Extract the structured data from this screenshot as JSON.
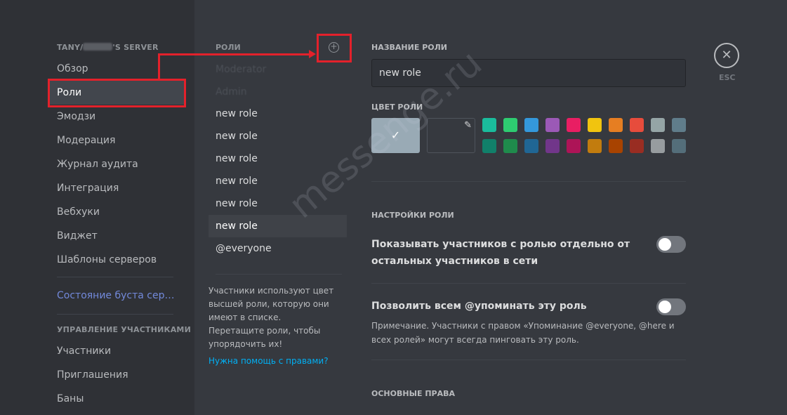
{
  "sidebar": {
    "server_name_prefix": "TANY/",
    "server_name_suffix": "'S SERVER",
    "items": [
      {
        "label": "Обзор"
      },
      {
        "label": "Роли"
      },
      {
        "label": "Эмодзи"
      },
      {
        "label": "Модерация"
      },
      {
        "label": "Журнал аудита"
      },
      {
        "label": "Интеграция"
      },
      {
        "label": "Вебхуки"
      },
      {
        "label": "Виджет"
      },
      {
        "label": "Шаблоны серверов"
      }
    ],
    "boost_label": "Состояние буста серв...",
    "members_header": "УПРАВЛЕНИЕ УЧАСТНИКАМИ",
    "member_items": [
      {
        "label": "Участники"
      },
      {
        "label": "Приглашения"
      },
      {
        "label": "Баны"
      }
    ]
  },
  "roles": {
    "header": "РОЛИ",
    "add_icon": "plus-circle-icon",
    "list": [
      {
        "label": "new role"
      },
      {
        "label": "new role"
      },
      {
        "label": "new role"
      },
      {
        "label": "new role"
      },
      {
        "label": "new role"
      },
      {
        "label": "new role"
      },
      {
        "label": "@everyone"
      }
    ],
    "note": "Участники используют цвет высшей роли, которую они имеют в списке. Перетащите роли, чтобы упорядочить их!",
    "help_link": "Нужна помощь с правами?"
  },
  "editor": {
    "name_label": "НАЗВАНИЕ РОЛИ",
    "name_value": "new role",
    "color_label": "ЦВЕТ РОЛИ",
    "default_check": "✓",
    "swatches_row1": [
      "#1abc9c",
      "#2ecc71",
      "#3498db",
      "#9b59b6",
      "#e91e63",
      "#f1c40f",
      "#e67e22",
      "#e74c3c",
      "#95a5a6",
      "#607d8b"
    ],
    "swatches_row2": [
      "#11806a",
      "#1f8b4c",
      "#206694",
      "#71368a",
      "#ad1457",
      "#c27c0e",
      "#a84300",
      "#992d22",
      "#979c9f",
      "#546e7a"
    ],
    "settings_label": "НАСТРОЙКИ РОЛИ",
    "setting1_line1": "Показывать участников с ролью отдельно от",
    "setting1_line2": "остальных участников в сети",
    "setting2_title": "Позволить всем @упоминать эту роль",
    "setting2_note": "Примечание. Участники с правом «Упоминание @everyone, @here и всех ролей» могут всегда пинговать эту роль.",
    "permissions_label": "ОСНОВНЫЕ ПРАВА"
  },
  "close": {
    "icon": "close-icon",
    "esc_label": "ESC"
  },
  "watermark": "messenge.ru",
  "colors": {
    "accent_red": "#e3212b",
    "link_blue": "#00b0f4",
    "blurple": "#7289da"
  }
}
